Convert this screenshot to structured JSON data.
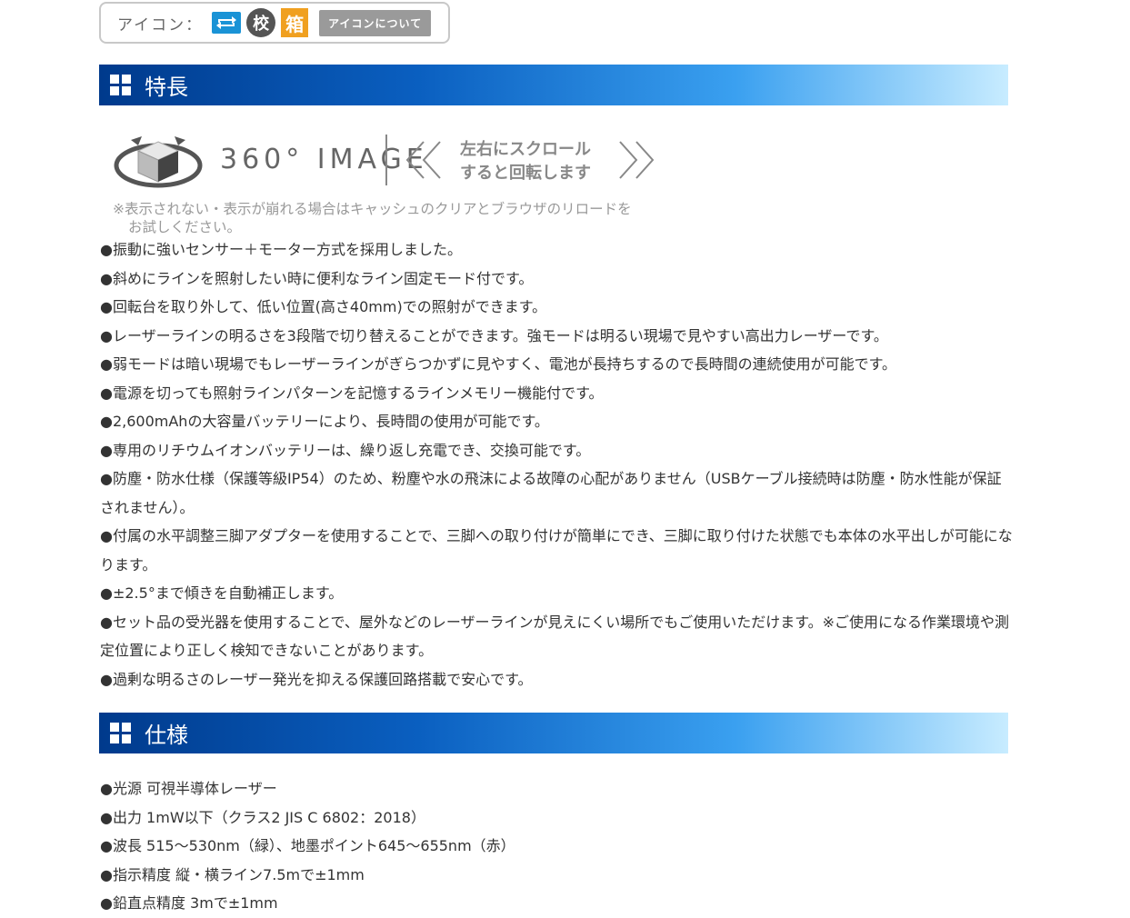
{
  "icons": {
    "label": "アイコン：",
    "icon1": "refresh-icon",
    "icon2_text": "校",
    "icon3_text": "箱",
    "about_button": "アイコンについて"
  },
  "features": {
    "heading": "特長",
    "banner": {
      "title": "360° IMAGE",
      "scroll_line1": "左右にスクロール",
      "scroll_line2": "すると回転します",
      "note_line1": "※表示されない・表示が崩れる場合はキャッシュのクリアとブラウザのリロードを",
      "note_line2": "お試しください。"
    },
    "items": [
      "●振動に強いセンサー＋モーター方式を採用しました。",
      "●斜めにラインを照射したい時に便利なライン固定モード付です。",
      "●回転台を取り外して、低い位置(高さ40mm)での照射ができます。",
      "●レーザーラインの明るさを3段階で切り替えることができます。強モードは明るい現場で見やすい高出力レーザーです。",
      "●弱モードは暗い現場でもレーザーラインがぎらつかずに見やすく、電池が長持ちするので長時間の連続使用が可能です。",
      "●電源を切っても照射ラインパターンを記憶するラインメモリー機能付です。",
      "●2,600mAhの大容量バッテリーにより、長時間の使用が可能です。",
      "●専用のリチウムイオンバッテリーは、繰り返し充電でき、交換可能です。",
      "●防塵・防水仕様（保護等級IP54）のため、粉塵や水の飛沫による故障の心配がありません（USBケーブル接続時は防塵・防水性能が保証されません）。",
      "●付属の水平調整三脚アダプターを使用することで、三脚への取り付けが簡単にでき、三脚に取り付けた状態でも本体の水平出しが可能になります。",
      "●±2.5°まで傾きを自動補正します。",
      "●セット品の受光器を使用することで、屋外などのレーザーラインが見えにくい場所でもご使用いただけます。※ご使用になる作業環境や測定位置により正しく検知できないことがあります。",
      "●過剰な明るさのレーザー発光を抑える保護回路搭載で安心です。"
    ]
  },
  "specs": {
    "heading": "仕様",
    "items": [
      "●光源 可視半導体レーザー",
      "●出力 1mW以下（クラス2 JIS C 6802：2018）",
      "●波長 515～530nm（緑）、地墨ポイント645～655nm（赤）",
      "●指示精度 縦・横ライン7.5mで±1mm",
      "●鉛直点精度 3mで±1mm"
    ]
  }
}
